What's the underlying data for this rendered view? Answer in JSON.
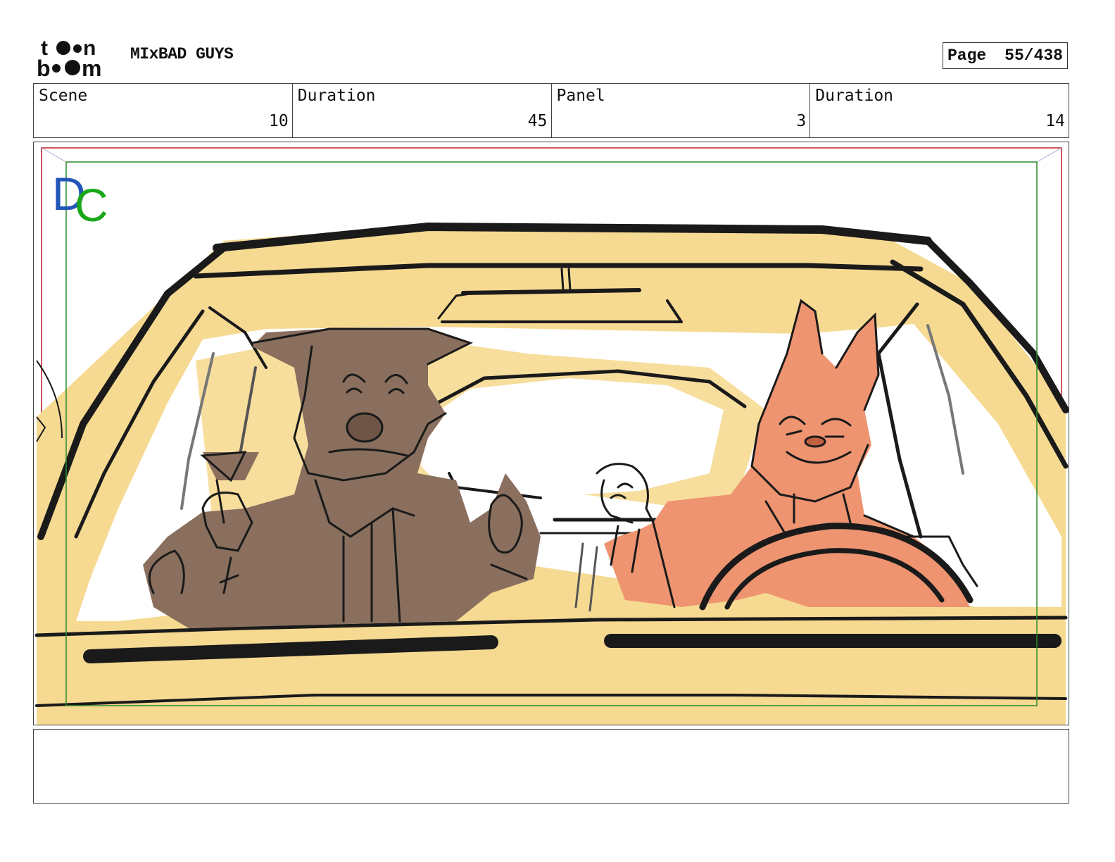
{
  "header": {
    "logo_text_top": "toon",
    "logo_text_bottom": "boom",
    "project_title": "MIxBAD GUYS",
    "page_label": "Page",
    "page_value": "55/438"
  },
  "info": {
    "scene_label": "Scene",
    "scene_value": "10",
    "scene_duration_label": "Duration",
    "scene_duration_value": "45",
    "panel_label": "Panel",
    "panel_value": "3",
    "panel_duration_label": "Duration",
    "panel_duration_value": "14"
  },
  "panel": {
    "watermark": "DC",
    "colors": {
      "car_body": "#f6da92",
      "outline": "#1a1a1a",
      "wolf": "#8a6f5e",
      "fox": "#ee9470",
      "safe_frame": "#2a8a2a",
      "action_frame": "#c0202a",
      "dc_d": "#2255b8",
      "dc_c": "#1aa81a"
    }
  },
  "notes": {
    "text": ""
  }
}
